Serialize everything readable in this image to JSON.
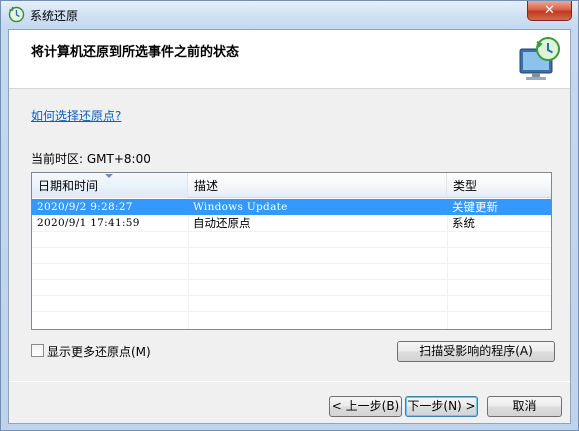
{
  "window": {
    "title": "系统还原",
    "close_label": "✕"
  },
  "header": {
    "title": "将计算机还原到所选事件之前的状态"
  },
  "help_link": "如何选择还原点?",
  "timezone_label": "当前时区: GMT+8:00",
  "table": {
    "columns": [
      "日期和时间",
      "描述",
      "类型"
    ],
    "rows": [
      {
        "datetime": "2020/9/2 9:28:27",
        "description": "Windows Update",
        "type": "关键更新",
        "selected": true
      },
      {
        "datetime": "2020/9/1 17:41:59",
        "description": "自动还原点",
        "type": "系统",
        "selected": false
      }
    ]
  },
  "checkbox": {
    "label": "显示更多还原点(M)",
    "checked": false
  },
  "buttons": {
    "scan": "扫描受影响的程序(A)",
    "back": "< 上一步(B)",
    "next": "下一步(N) >",
    "cancel": "取消"
  },
  "colors": {
    "selection": "#3399ff",
    "link": "#0a5ec5",
    "close": "#c2381e"
  },
  "icons": {
    "title": "system-restore-icon",
    "header": "monitor-restore-icon",
    "sort": "sort-arrow-icon"
  }
}
